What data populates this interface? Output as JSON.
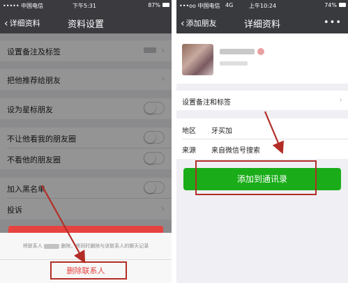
{
  "left": {
    "status": {
      "carrier": "••••• 中国电信",
      "time": "下午5:31",
      "battery": "87%"
    },
    "nav": {
      "back_label": "详细资料",
      "title": "资料设置"
    },
    "items": [
      {
        "label": "设置备注及标签"
      },
      {
        "label": "把他推荐给朋友"
      },
      {
        "label": "设为星标朋友"
      },
      {
        "label": "不让他看我的朋友圈"
      },
      {
        "label": "不看他的朋友圈"
      },
      {
        "label": "加入黑名单"
      },
      {
        "label": "投诉"
      }
    ],
    "sheet": {
      "message_before": "将联系人",
      "message_after": "删除，将同时删除与该联系人的聊天记录",
      "delete_label": "删除联系人"
    }
  },
  "right": {
    "status": {
      "carrier": "•••oo 中国电信",
      "network": "4G",
      "time": "上午10:24",
      "battery": "74%"
    },
    "nav": {
      "back_label": "添加朋友",
      "title": "详细资料",
      "more": "•••"
    },
    "remark_label": "设置备注和标签",
    "region": {
      "label": "地区",
      "value": "牙买加"
    },
    "source": {
      "label": "来源",
      "value": "来自微信号搜索"
    },
    "add_button": "添加到通讯录"
  },
  "colors": {
    "annotation": "#b22d26",
    "danger": "#e64340",
    "primary": "#1aad19",
    "navbar": "#3a3a3f"
  }
}
